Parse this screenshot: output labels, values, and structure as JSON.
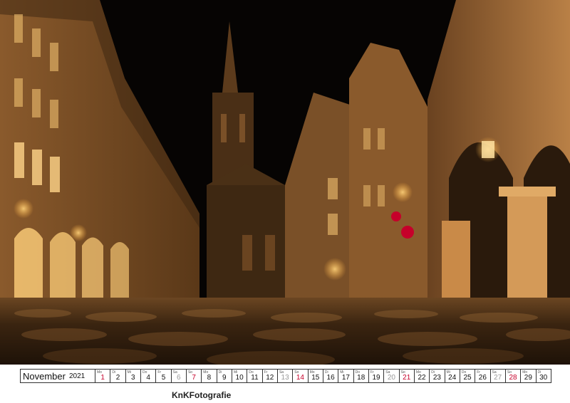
{
  "calendar": {
    "month": "November",
    "year": "2021",
    "days": [
      {
        "dow": "Mo",
        "num": "1",
        "kind": "hol"
      },
      {
        "dow": "Di",
        "num": "2",
        "kind": ""
      },
      {
        "dow": "Mi",
        "num": "3",
        "kind": ""
      },
      {
        "dow": "Do",
        "num": "4",
        "kind": ""
      },
      {
        "dow": "Fr",
        "num": "5",
        "kind": ""
      },
      {
        "dow": "Sa",
        "num": "6",
        "kind": "sat"
      },
      {
        "dow": "So",
        "num": "7",
        "kind": "sun"
      },
      {
        "dow": "Mo",
        "num": "8",
        "kind": ""
      },
      {
        "dow": "Di",
        "num": "9",
        "kind": ""
      },
      {
        "dow": "Mi",
        "num": "10",
        "kind": ""
      },
      {
        "dow": "Do",
        "num": "11",
        "kind": ""
      },
      {
        "dow": "Fr",
        "num": "12",
        "kind": ""
      },
      {
        "dow": "Sa",
        "num": "13",
        "kind": "sat"
      },
      {
        "dow": "So",
        "num": "14",
        "kind": "sun"
      },
      {
        "dow": "Mo",
        "num": "15",
        "kind": ""
      },
      {
        "dow": "Di",
        "num": "16",
        "kind": ""
      },
      {
        "dow": "Mi",
        "num": "17",
        "kind": ""
      },
      {
        "dow": "Do",
        "num": "18",
        "kind": ""
      },
      {
        "dow": "Fr",
        "num": "19",
        "kind": ""
      },
      {
        "dow": "Sa",
        "num": "20",
        "kind": "sat"
      },
      {
        "dow": "So",
        "num": "21",
        "kind": "sun"
      },
      {
        "dow": "Mo",
        "num": "22",
        "kind": ""
      },
      {
        "dow": "Di",
        "num": "23",
        "kind": ""
      },
      {
        "dow": "Mi",
        "num": "24",
        "kind": ""
      },
      {
        "dow": "Do",
        "num": "25",
        "kind": ""
      },
      {
        "dow": "Fr",
        "num": "26",
        "kind": ""
      },
      {
        "dow": "Sa",
        "num": "27",
        "kind": "sat"
      },
      {
        "dow": "So",
        "num": "28",
        "kind": "sun"
      },
      {
        "dow": "Mo",
        "num": "29",
        "kind": ""
      },
      {
        "dow": "Di",
        "num": "30",
        "kind": ""
      }
    ]
  },
  "credit": "KnKFotografie",
  "colors": {
    "sunday": "#c6002a",
    "saturday": "#999999",
    "night_sky": "#050402",
    "lamp_glow": "#f2a94a",
    "stone": "#c98a48"
  }
}
